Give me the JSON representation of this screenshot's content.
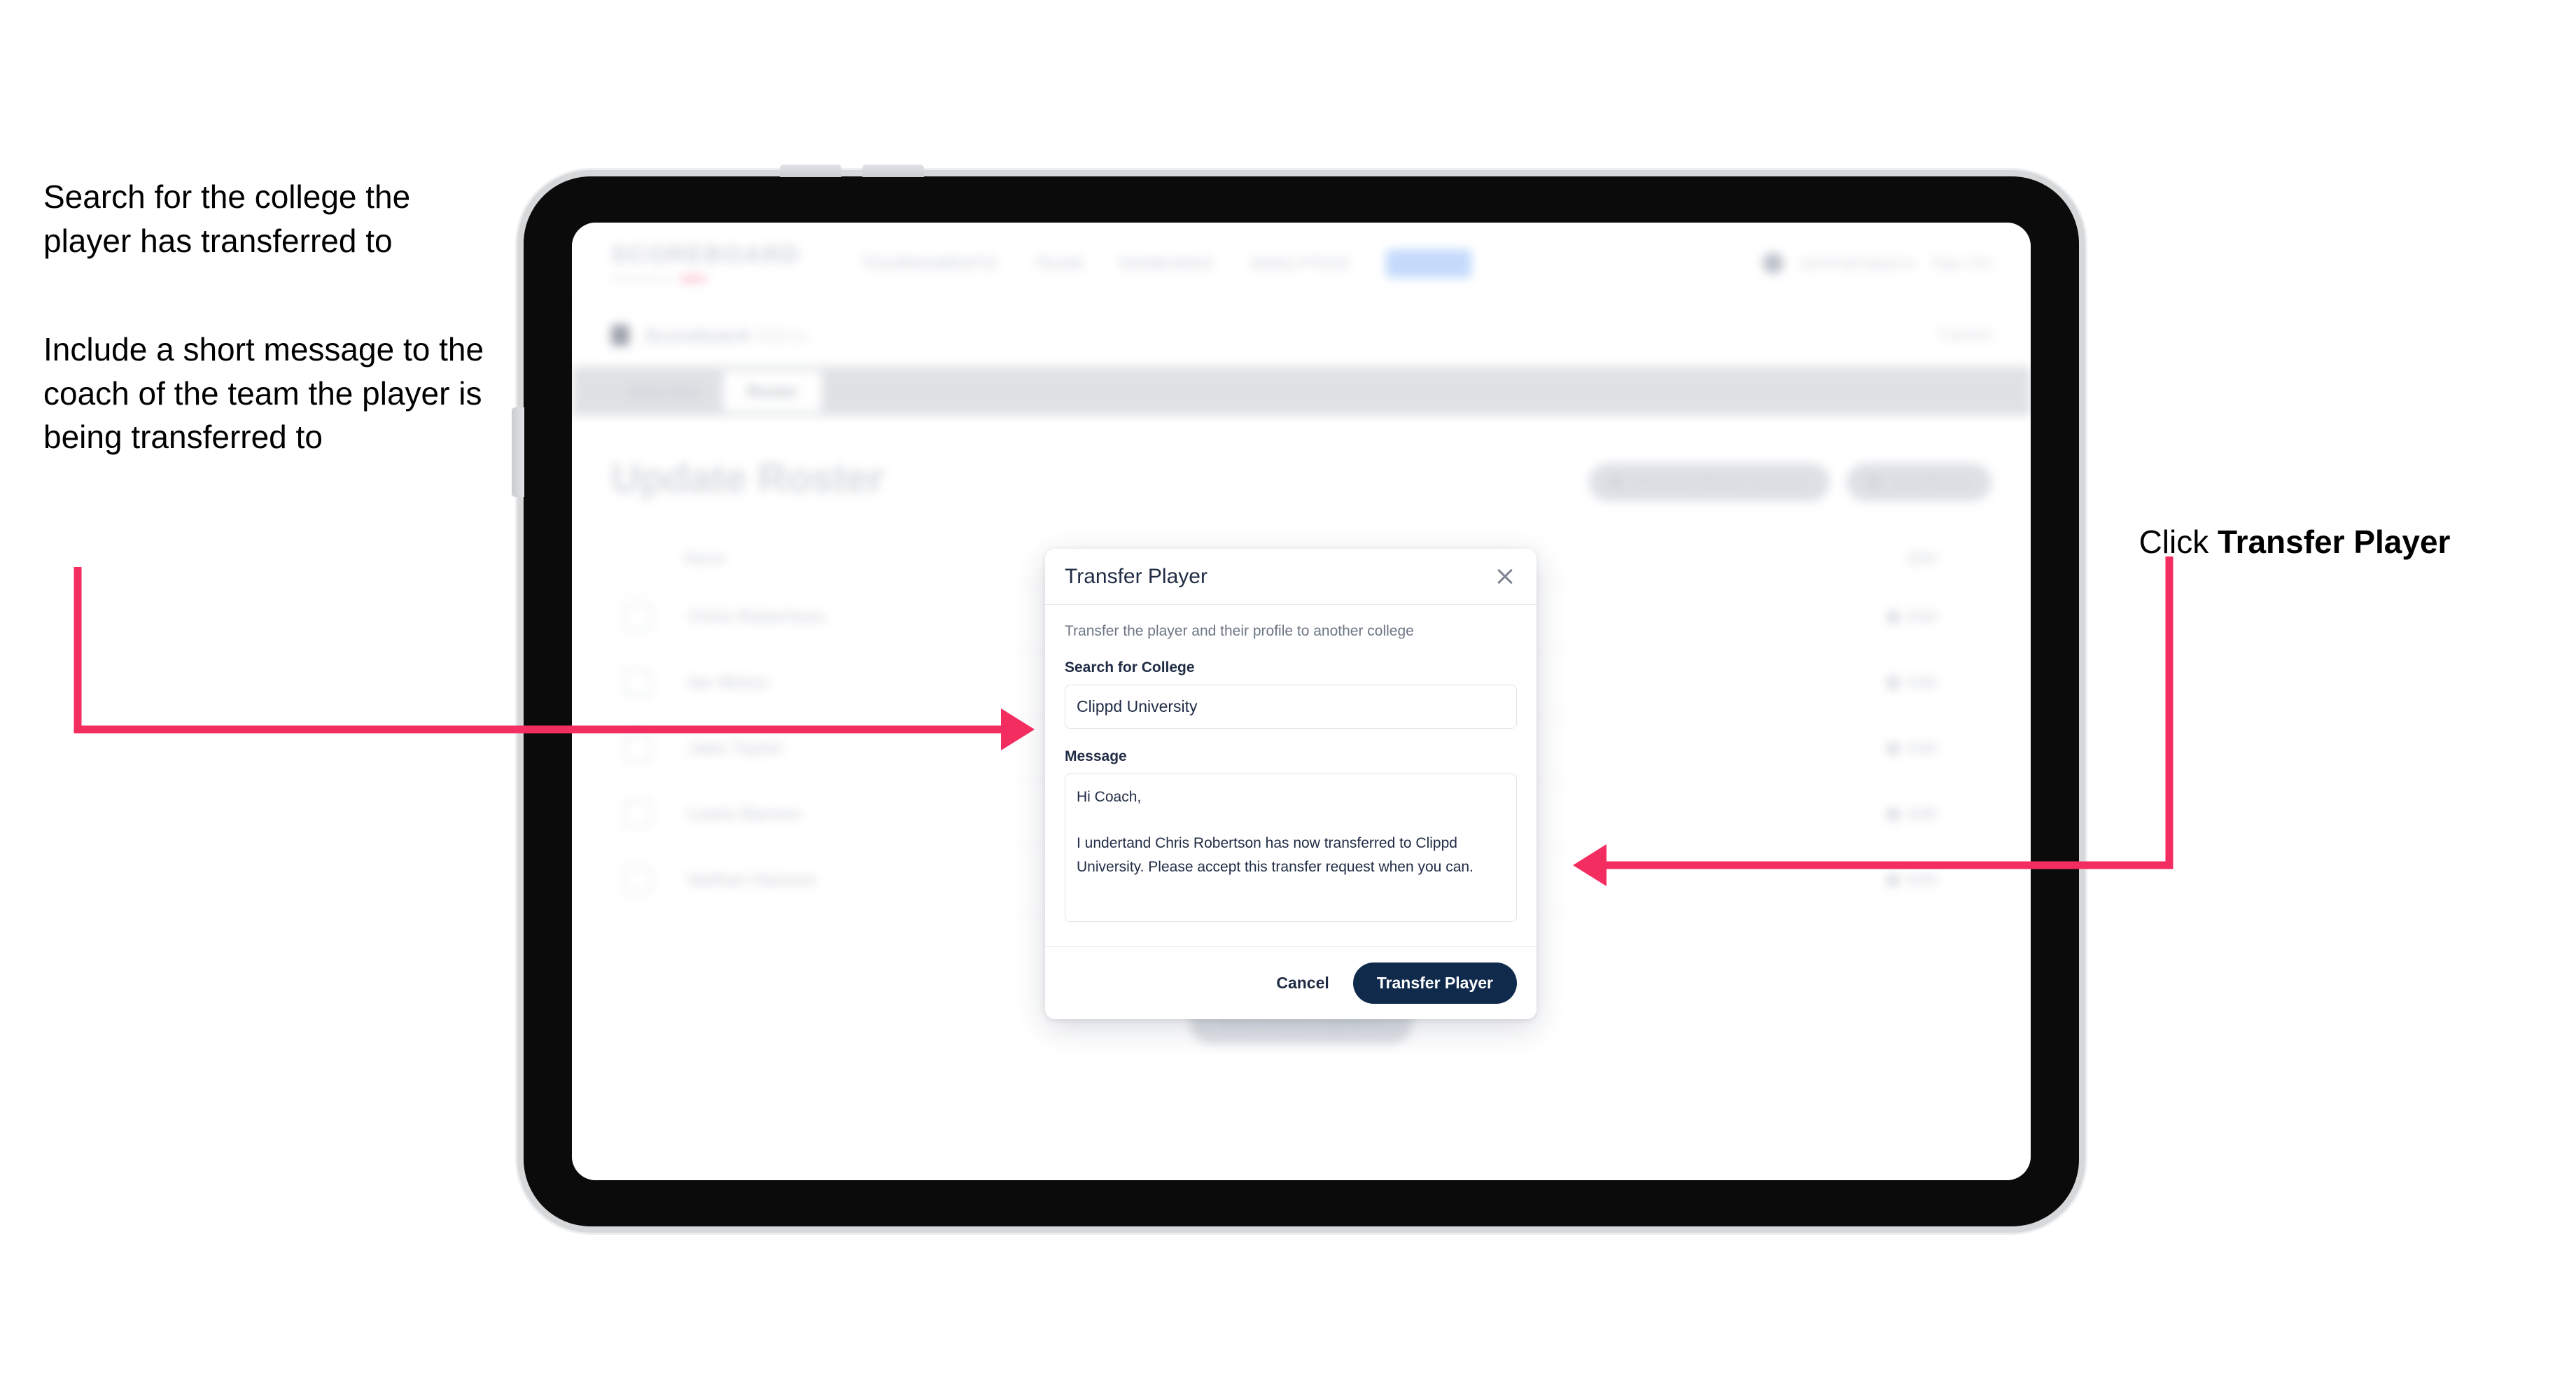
{
  "annotations": {
    "left_note_1": "Search for the college the player has transferred to",
    "left_note_2": "Include a short message to the coach of the team the player is being transferred to",
    "right_note_prefix": "Click ",
    "right_note_bold": "Transfer Player"
  },
  "app": {
    "brand": {
      "wordmark": "SCOREBOARD",
      "subline": "Powered by"
    },
    "nav_links": [
      {
        "label": "TOURNAMENTS",
        "chip": false
      },
      {
        "label": "TEAM",
        "chip": false
      },
      {
        "label": "RANKINGS",
        "chip": false
      },
      {
        "label": "ANALYTICS",
        "chip": false
      },
      {
        "label": "ADMIN",
        "chip": true
      }
    ],
    "nav_right": {
      "account": "admin@clippd.io",
      "signout": "Sign Out"
    },
    "subheader": {
      "title": "Scoreboard",
      "title_muted": "Admin",
      "cancel": "Cancel"
    },
    "tabs": [
      {
        "label": "Overview",
        "active": false
      },
      {
        "label": "Roster",
        "active": true
      }
    ],
    "page": {
      "title": "Update Roster",
      "actions": [
        {
          "label": "Request Player Transfer"
        },
        {
          "label": "Add Player"
        }
      ],
      "table": {
        "columns": [
          "Name",
          "Edit"
        ],
        "rows": [
          {
            "name": "Chris Robertson",
            "action": "Edit"
          },
          {
            "name": "Ian Weiss",
            "action": "Edit"
          },
          {
            "name": "Jake Taylor",
            "action": "Edit"
          },
          {
            "name": "Lewis Barnes",
            "action": "Edit"
          },
          {
            "name": "Nathan Hanson",
            "action": "Edit"
          }
        ]
      },
      "save_button": "Save Roster Updates"
    }
  },
  "dialog": {
    "title": "Transfer Player",
    "subtitle": "Transfer the player and their profile to another college",
    "college_label": "Search for College",
    "college_value": "Clippd University",
    "college_placeholder": "Search for College",
    "message_label": "Message",
    "message_value": "Hi Coach,\n\nI undertand Chris Robertson has now transferred to Clippd University. Please accept this transfer request when you can.",
    "message_placeholder": "Message",
    "cancel_label": "Cancel",
    "submit_label": "Transfer Player"
  },
  "colors": {
    "accent_pink": "#f42d61",
    "brand_navy": "#102a4c",
    "text_dark": "#1f2b44"
  }
}
